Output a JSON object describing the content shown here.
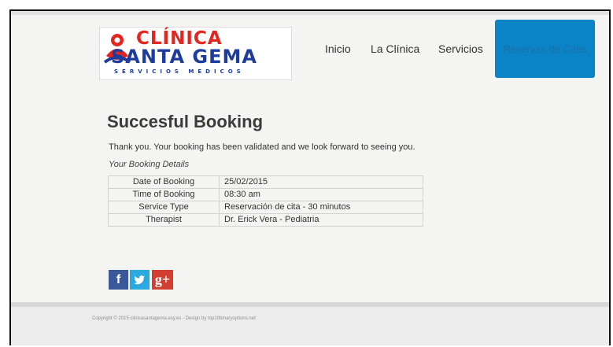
{
  "logo": {
    "line1": "CLÍNICA",
    "line2": "SANTA GEMA",
    "line3": "SERVICIOS MEDICOS"
  },
  "nav": {
    "items": [
      "Inicio",
      "La Clínica",
      "Servicios"
    ],
    "active": "Reservas de Citas"
  },
  "content": {
    "title": "Succesful Booking",
    "thanks": "Thank you. Your booking has been validated and we look forward to seeing you.",
    "details_label": "Your Booking Details",
    "rows": [
      {
        "label": "Date of Booking",
        "value": "25/02/2015"
      },
      {
        "label": "Time of Booking",
        "value": "08:30 am"
      },
      {
        "label": "Service Type",
        "value": "Reservación de cita - 30 minutos"
      },
      {
        "label": "Therapist",
        "value": "Dr. Erick Vera - Pediatria"
      }
    ]
  },
  "social": {
    "facebook": "f",
    "twitter": "t",
    "googleplus": "g+"
  },
  "footer": {
    "copyright": "Copyright © 2015 clinicasantagema.esy.es - Design by top10binaryoptions.net"
  },
  "colors": {
    "accent": "#0a84c6",
    "logo_red": "#e5261f",
    "logo_blue": "#1e3c9c"
  }
}
